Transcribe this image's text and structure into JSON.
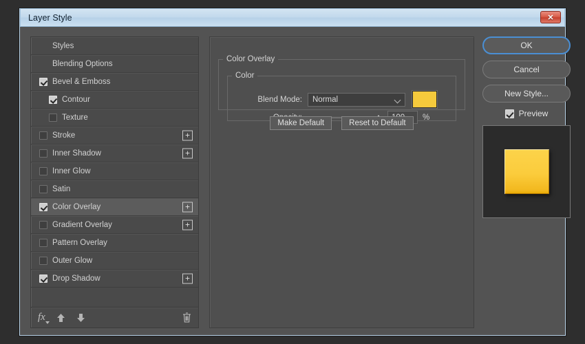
{
  "window": {
    "title": "Layer Style",
    "close_label": "✕",
    "close_icon": "close-icon"
  },
  "styles_panel": {
    "items": [
      {
        "label": "Styles",
        "checkbox": "none",
        "indent": false,
        "plus": false,
        "selected": false
      },
      {
        "label": "Blending Options",
        "checkbox": "none",
        "indent": false,
        "plus": false,
        "selected": false
      },
      {
        "label": "Bevel & Emboss",
        "checkbox": "checked",
        "indent": false,
        "plus": false,
        "selected": false
      },
      {
        "label": "Contour",
        "checkbox": "checked",
        "indent": true,
        "plus": false,
        "selected": false
      },
      {
        "label": "Texture",
        "checkbox": "unchecked",
        "indent": true,
        "plus": false,
        "selected": false
      },
      {
        "label": "Stroke",
        "checkbox": "unchecked",
        "indent": false,
        "plus": true,
        "selected": false
      },
      {
        "label": "Inner Shadow",
        "checkbox": "unchecked",
        "indent": false,
        "plus": true,
        "selected": false
      },
      {
        "label": "Inner Glow",
        "checkbox": "unchecked",
        "indent": false,
        "plus": false,
        "selected": false
      },
      {
        "label": "Satin",
        "checkbox": "unchecked",
        "indent": false,
        "plus": false,
        "selected": false
      },
      {
        "label": "Color Overlay",
        "checkbox": "checked",
        "indent": false,
        "plus": true,
        "selected": true
      },
      {
        "label": "Gradient Overlay",
        "checkbox": "unchecked",
        "indent": false,
        "plus": true,
        "selected": false
      },
      {
        "label": "Pattern Overlay",
        "checkbox": "unchecked",
        "indent": false,
        "plus": false,
        "selected": false
      },
      {
        "label": "Outer Glow",
        "checkbox": "unchecked",
        "indent": false,
        "plus": false,
        "selected": false
      },
      {
        "label": "Drop Shadow",
        "checkbox": "checked",
        "indent": false,
        "plus": true,
        "selected": false
      }
    ],
    "plus_glyph": "+",
    "toolbar": {
      "fx_label": "fx",
      "fx_icon": "fx-icon",
      "move_up_icon": "arrow-up-icon",
      "move_down_icon": "arrow-down-icon",
      "delete_icon": "trash-icon"
    }
  },
  "settings": {
    "group_title": "Color Overlay",
    "subgroup_title": "Color",
    "blend_mode": {
      "label": "Blend Mode:",
      "value": "Normal"
    },
    "color_swatch_hex": "#F5CA3C",
    "opacity": {
      "label": "Opacity:",
      "value": "100",
      "unit": "%",
      "percent": 100
    },
    "make_default_label": "Make Default",
    "reset_default_label": "Reset to Default"
  },
  "actions": {
    "ok_label": "OK",
    "cancel_label": "Cancel",
    "new_style_label": "New Style...",
    "preview_label": "Preview",
    "preview_checked": true
  },
  "colors": {
    "accent_blue": "#4a8fd4",
    "swatch_yellow": "#F5CA3C",
    "dialog_bg": "#535353",
    "panel_bg": "#4f4f4f",
    "selected_row": "#5c5c5c"
  }
}
